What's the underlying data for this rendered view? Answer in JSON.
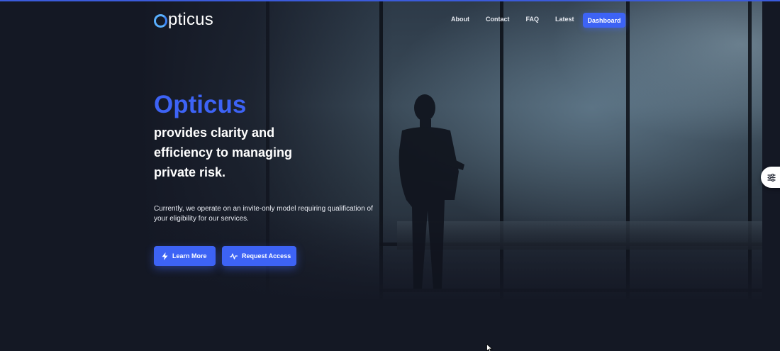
{
  "brand": {
    "logo_text": "pticus",
    "accent": "#3d63f5"
  },
  "nav": {
    "links": [
      "About",
      "Contact",
      "FAQ",
      "Latest"
    ],
    "dashboard_label": "Dashboard"
  },
  "hero": {
    "title": "Opticus",
    "tagline": "provides clarity and efficiency to managing private risk.",
    "description": "Currently, we operate on an invite-only model requiring qualification of your eligibility for our services.",
    "buttons": {
      "learn_more": "Learn More",
      "request_access": "Request Access"
    }
  },
  "icons": {
    "learn_more": "lightning-icon",
    "request_access": "activity-icon",
    "settings_tab": "sliders-icon"
  }
}
